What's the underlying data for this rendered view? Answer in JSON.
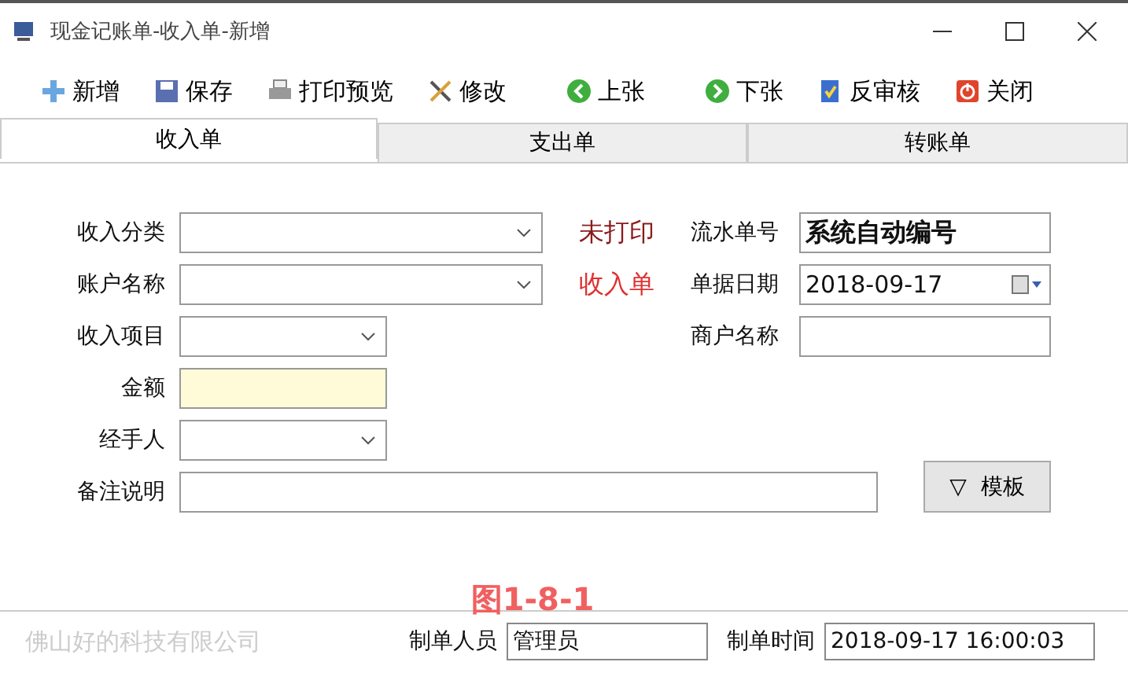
{
  "window": {
    "title": "现金记账单-收入单-新增"
  },
  "toolbar": [
    {
      "label": "新增"
    },
    {
      "label": "保存"
    },
    {
      "label": "打印预览"
    },
    {
      "label": "修改"
    },
    {
      "label": "上张"
    },
    {
      "label": "下张"
    },
    {
      "label": "反审核"
    },
    {
      "label": "关闭"
    }
  ],
  "tabs": [
    {
      "label": "收入单",
      "selected": true
    },
    {
      "label": "支出单",
      "selected": false
    },
    {
      "label": "转账单",
      "selected": false
    }
  ],
  "left_fields": [
    {
      "label": "收入分类",
      "kind": "select"
    },
    {
      "label": "账户名称",
      "kind": "select"
    },
    {
      "label": "收入项目",
      "kind": "select"
    },
    {
      "label": "金额",
      "kind": "amount"
    },
    {
      "label": "经手人",
      "kind": "select"
    }
  ],
  "status": [
    {
      "text": "未打印",
      "kind": "print"
    },
    {
      "text": "收入单",
      "kind": "type"
    }
  ],
  "right_fields": [
    {
      "label": "流水单号",
      "kind": "bold",
      "value": "系统自动编号"
    },
    {
      "label": "单据日期",
      "kind": "date",
      "value": "2018-09-17"
    },
    {
      "label": "商户名称",
      "kind": "text"
    }
  ],
  "remark": {
    "label": "备注说明"
  },
  "template_button": {
    "icon": "▽",
    "label": "模板"
  },
  "figure_label": "图1-8-1",
  "footer": {
    "company": "佛山好的科技有限公司",
    "creator_label": "制单人员",
    "creator": "管理员",
    "time_label": "制单时间",
    "time": "2018-09-17 16:00:03"
  }
}
